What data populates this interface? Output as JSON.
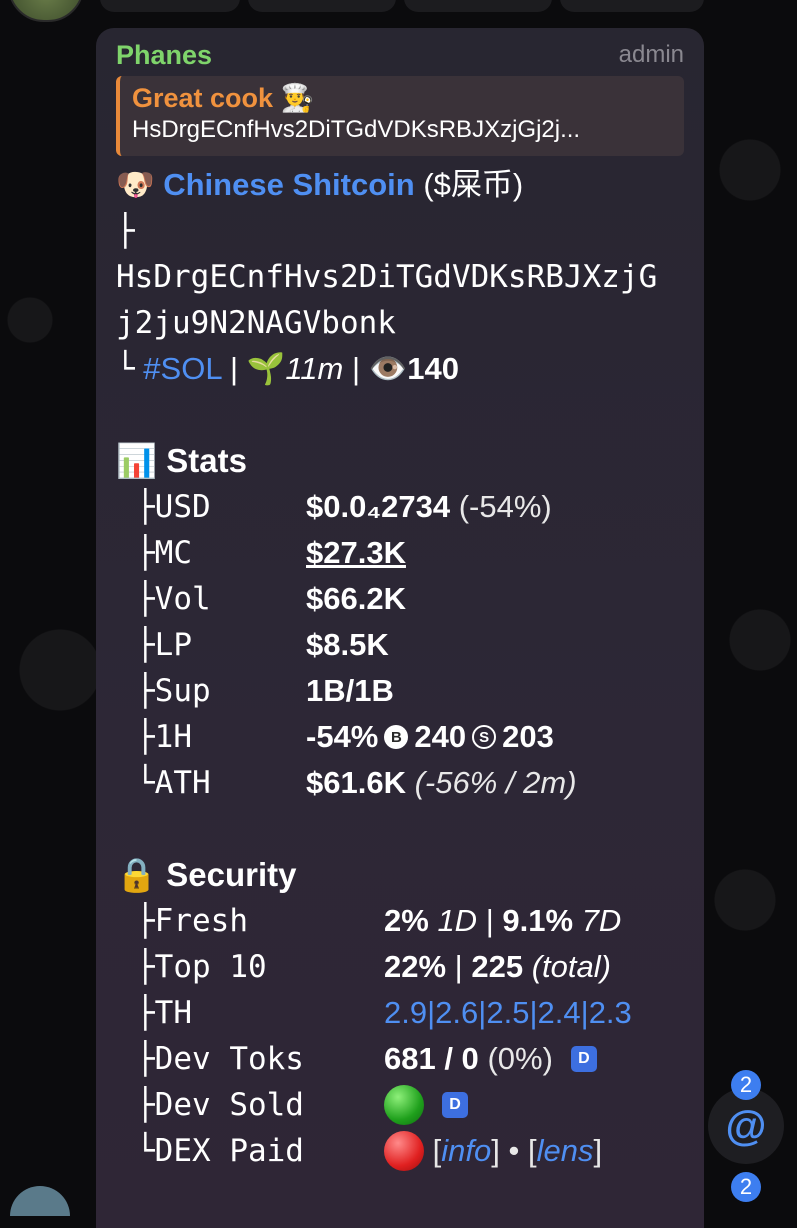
{
  "message": {
    "sender": "Phanes",
    "role": "admin",
    "reply": {
      "title": "Great cook 👨‍🍳",
      "text": "HsDrgECnfHvs2DiTGdVDKsRBJXzjGj2j..."
    },
    "token": {
      "emoji": "🐶",
      "name": "Chinese Shitcoin",
      "ticker": "($屎币)",
      "branch": "├",
      "address_line1": "HsDrgECnfHvs2DiTGdVDKsRBJXzjG",
      "address_line2": "j2ju9N2NAGVbonk",
      "chain_prefix": "└",
      "chain": "#SOL",
      "sep": "|",
      "age_emoji": "🌱",
      "age": "11m",
      "views_emoji": "👁️",
      "views": "140"
    },
    "stats": {
      "emoji": "📊",
      "title": "Stats",
      "usd": {
        "key": "├USD",
        "value": "$0.0₄2734",
        "change": "(-54%)"
      },
      "mc": {
        "key": "├MC",
        "value": "$27.3K"
      },
      "vol": {
        "key": "├Vol",
        "value": "$66.2K"
      },
      "lp": {
        "key": "├LP",
        "value": "$8.5K"
      },
      "sup": {
        "key": "├Sup",
        "value": "1B/1B"
      },
      "h1": {
        "key": "├1H",
        "value": "-54%",
        "buy_icon": "B",
        "buys": "240",
        "sell_icon": "S",
        "sells": "203"
      },
      "ath": {
        "key": "└ATH",
        "value": "$61.6K",
        "detail": "(-56% / 2m)"
      }
    },
    "security": {
      "emoji": "🔒",
      "title": "Security",
      "fresh": {
        "key": "├Fresh",
        "v1": "2%",
        "p1": "1D",
        "sep": "|",
        "v2": "9.1%",
        "p2": "7D"
      },
      "top10": {
        "key": "├Top 10",
        "v1": "22%",
        "sep": "|",
        "v2": "225",
        "p2": "(total)"
      },
      "th": {
        "key": "├TH",
        "values": [
          "2.9",
          "2.6",
          "2.5",
          "2.4",
          "2.3"
        ],
        "sep": "|"
      },
      "dev_toks": {
        "key": "├Dev Toks",
        "value": "681 / 0",
        "pct": "(0%)",
        "tag": "D"
      },
      "dev_sold": {
        "key": "├Dev Sold",
        "status": "green",
        "tag": "D"
      },
      "dex_paid": {
        "key": "└DEX Paid",
        "status": "red",
        "lb1": "[",
        "link1": "info",
        "rb1": "]",
        "dot": "•",
        "lb2": "[",
        "link2": "lens",
        "rb2": "]"
      }
    }
  },
  "fab": {
    "icon": "@",
    "badge": "2"
  },
  "badge_bottom": "2",
  "colors": {
    "link": "#4f8ff2",
    "sender": "#7fd46b",
    "reply_accent": "#e8893a"
  }
}
